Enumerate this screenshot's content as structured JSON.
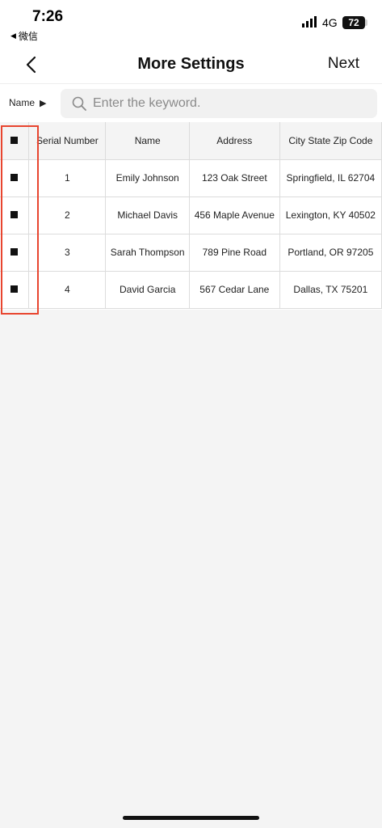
{
  "status_bar": {
    "time": "7:26",
    "back_app": "微信",
    "network": "4G",
    "battery": "72"
  },
  "nav": {
    "title": "More Settings",
    "next_label": "Next",
    "back_icon": "chevron-left-icon"
  },
  "search": {
    "filter_label": "Name",
    "placeholder": "Enter the keyword.",
    "value": ""
  },
  "table": {
    "columns": [
      "Serial Number",
      "Name",
      "Address",
      "City State Zip Code"
    ],
    "rows": [
      {
        "serial": "1",
        "name": "Emily Johnson",
        "address": "123 Oak Street",
        "city": "Springfield, IL 62704"
      },
      {
        "serial": "2",
        "name": "Michael Davis",
        "address": "456 Maple Avenue",
        "city": "Lexington, KY 40502"
      },
      {
        "serial": "3",
        "name": "Sarah Thompson",
        "address": "789 Pine Road",
        "city": "Portland, OR 97205"
      },
      {
        "serial": "4",
        "name": "David Garcia",
        "address": "567 Cedar Lane",
        "city": "Dallas, TX 75201"
      }
    ]
  },
  "colors": {
    "highlight": "#e8452f",
    "background": "#f4f4f4"
  }
}
